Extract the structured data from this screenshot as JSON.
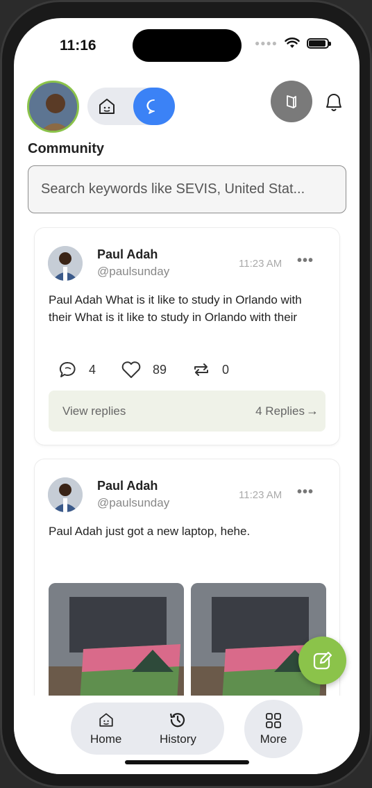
{
  "status_bar": {
    "time": "11:16"
  },
  "header": {
    "section_title": "Community",
    "search_placeholder": "Search keywords like SEVIS, United Stat..."
  },
  "posts": [
    {
      "author": "Paul Adah",
      "handle": "@paulsunday",
      "time": "11:23 AM",
      "text": "Paul Adah What is it like to study in Orlando with their What is it like to study in Orlando with their",
      "comments": "4",
      "likes": "89",
      "reposts": "0",
      "view_replies_label": "View replies",
      "replies_label": "4 Replies"
    },
    {
      "author": "Paul Adah",
      "handle": "@paulsunday",
      "time": "11:23 AM",
      "text": "Paul Adah just got a new laptop, hehe."
    }
  ],
  "bottom_nav": {
    "home_label": "Home",
    "history_label": "History",
    "more_label": "More"
  },
  "colors": {
    "accent_blue": "#3b82f6",
    "accent_green": "#8bc34a",
    "reply_bar": "#eff2e8"
  },
  "icons": [
    "home-icon",
    "chat-icon",
    "book-icon",
    "bell-icon",
    "comment-icon",
    "heart-icon",
    "repost-icon",
    "more-dots-icon",
    "arrow-right-icon",
    "edit-icon",
    "history-icon",
    "grid-icon"
  ]
}
